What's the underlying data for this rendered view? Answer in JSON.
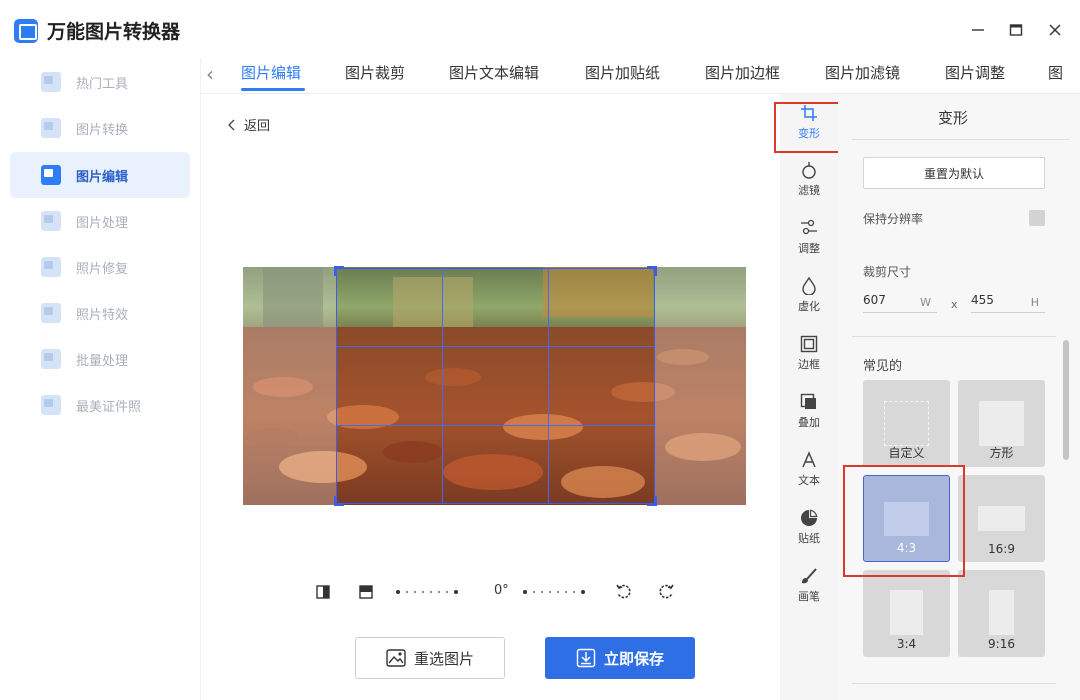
{
  "app": {
    "title": "万能图片转换器"
  },
  "sidebar": {
    "items": [
      {
        "label": "热门工具",
        "active": false
      },
      {
        "label": "图片转换",
        "active": false
      },
      {
        "label": "图片编辑",
        "active": true
      },
      {
        "label": "图片处理",
        "active": false
      },
      {
        "label": "照片修复",
        "active": false
      },
      {
        "label": "照片特效",
        "active": false
      },
      {
        "label": "批量处理",
        "active": false
      },
      {
        "label": "最美证件照",
        "active": false
      }
    ]
  },
  "tabs": [
    {
      "label": "图片编辑",
      "active": true
    },
    {
      "label": "图片裁剪",
      "active": false
    },
    {
      "label": "图片文本编辑",
      "active": false
    },
    {
      "label": "图片加贴纸",
      "active": false
    },
    {
      "label": "图片加边框",
      "active": false
    },
    {
      "label": "图片加滤镜",
      "active": false
    },
    {
      "label": "图片调整",
      "active": false
    },
    {
      "label": "图",
      "active": false
    }
  ],
  "editor": {
    "back_label": "返回",
    "rotation": "0°",
    "reselect_label": "重选图片",
    "save_label": "立即保存"
  },
  "rail": {
    "items": [
      {
        "label": "变形",
        "icon": "transform-icon",
        "active": true
      },
      {
        "label": "滤镜",
        "icon": "filter-icon",
        "active": false
      },
      {
        "label": "调整",
        "icon": "adjust-icon",
        "active": false
      },
      {
        "label": "虚化",
        "icon": "blur-icon",
        "active": false
      },
      {
        "label": "边框",
        "icon": "frame-icon",
        "active": false
      },
      {
        "label": "叠加",
        "icon": "overlay-icon",
        "active": false
      },
      {
        "label": "文本",
        "icon": "text-icon",
        "active": false
      },
      {
        "label": "贴纸",
        "icon": "sticker-icon",
        "active": false
      },
      {
        "label": "画笔",
        "icon": "brush-icon",
        "active": false
      }
    ]
  },
  "panel": {
    "title": "变形",
    "reset_label": "重置为默认",
    "keep_resolution_label": "保持分辨率",
    "keep_resolution_checked": false,
    "crop_size_label": "裁剪尺寸",
    "width": "607",
    "width_unit": "W",
    "x_sep": "x",
    "height": "455",
    "height_unit": "H",
    "common_label": "常见的",
    "ratios": [
      {
        "label": "自定义",
        "selected": false
      },
      {
        "label": "方形",
        "selected": false
      },
      {
        "label": "4:3",
        "selected": true
      },
      {
        "label": "16:9",
        "selected": false
      },
      {
        "label": "3:4",
        "selected": false
      },
      {
        "label": "9:16",
        "selected": false
      }
    ]
  },
  "colors": {
    "accent": "#2f7df6",
    "highlight": "#d93a2b",
    "crop_grid": "#3b5de8"
  }
}
